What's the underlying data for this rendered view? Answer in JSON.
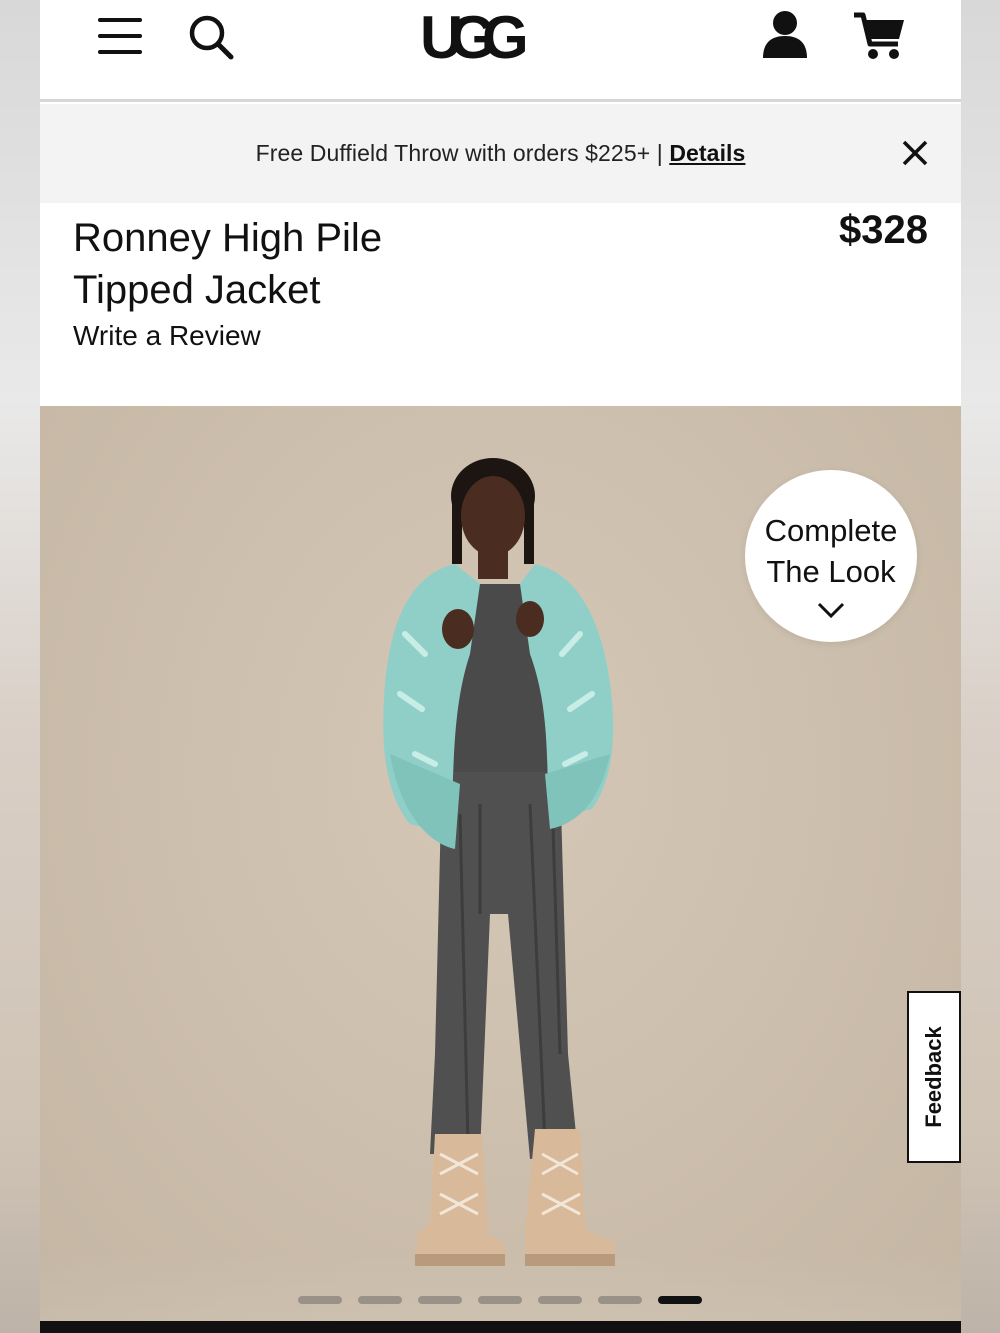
{
  "header": {
    "logo_text": "UGG",
    "menu_icon": "hamburger-menu-icon",
    "search_icon": "search-icon",
    "account_icon": "account-icon",
    "cart_icon": "cart-icon"
  },
  "promo": {
    "text": "Free Duffield Throw with orders $225+ | ",
    "link_label": "Details",
    "close_icon": "close-icon"
  },
  "product": {
    "title_line1": "Ronney High Pile",
    "title_line2": "Tipped Jacket",
    "price": "$328",
    "review_link": "Write a Review"
  },
  "hero": {
    "complete_look_line1": "Complete",
    "complete_look_line2": "The Look",
    "feedback_label": "Feedback",
    "carousel": {
      "total": 7,
      "active_index": 6
    }
  },
  "colors": {
    "text": "#111111",
    "promo_bg": "#f3f3f3",
    "hero_bg": "#cdbfad",
    "jacket": "#8fcfc8",
    "knit": "#4a4a4a",
    "boots": "#d8b99a"
  }
}
